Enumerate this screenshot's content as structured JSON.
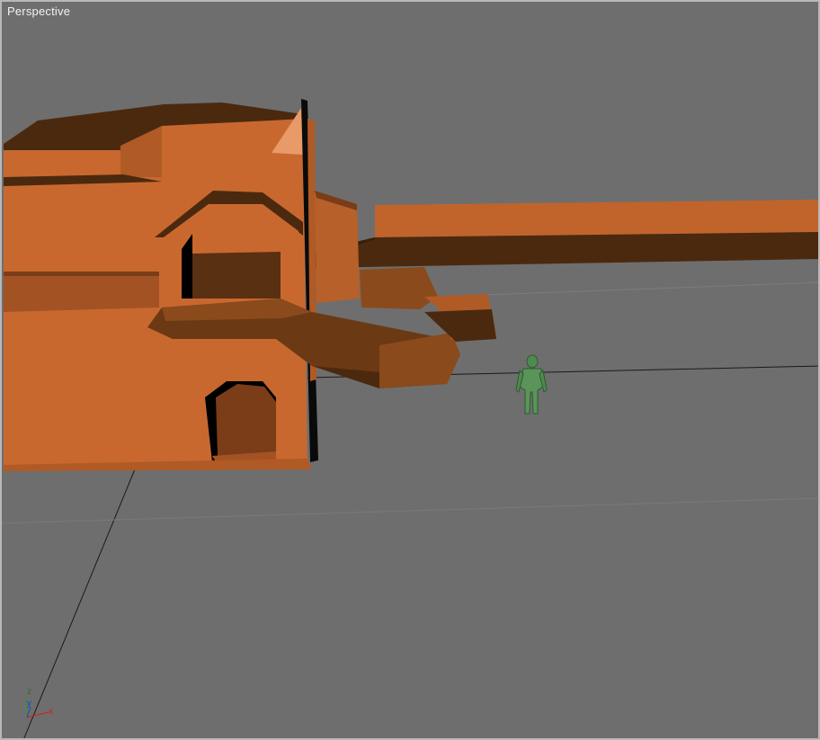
{
  "viewport": {
    "label": "Perspective",
    "background": "#6e6e6e"
  },
  "scene": {
    "model_color_light": "#c8682f",
    "model_color_dark": "#4a2810",
    "character_color": "#4f8a4f"
  },
  "axis_gizmo": {
    "z": "z",
    "y": "y",
    "x": "x",
    "colors": {
      "x": "#d02020",
      "y": "#2040d0",
      "z": "#20a020"
    }
  }
}
